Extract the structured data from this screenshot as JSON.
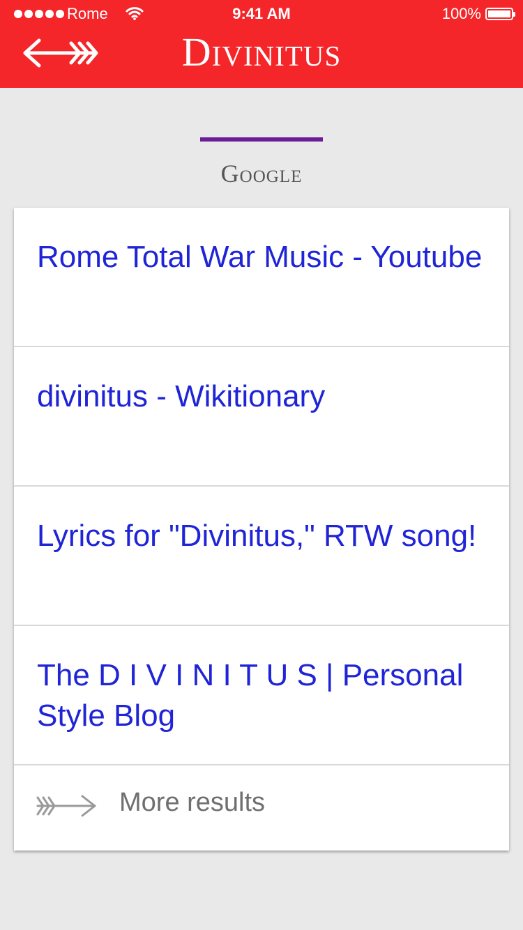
{
  "status_bar": {
    "carrier": "Rome",
    "time": "9:41 AM",
    "battery": "100%"
  },
  "header": {
    "title": "Divinitus",
    "back_icon": "arrow-left-icon",
    "background_color": "#f5262a"
  },
  "section": {
    "title": "Google",
    "accent_color": "#6b1d95"
  },
  "results": [
    {
      "title": "Rome Total War Music - Youtube"
    },
    {
      "title": "divinitus - Wikitionary"
    },
    {
      "title": "Lyrics for \"Divinitus,\" RTW song!"
    },
    {
      "title": "The D I V I N I T U S | Personal Style Blog"
    }
  ],
  "more": {
    "label": "More results",
    "icon": "arrow-right-icon"
  },
  "colors": {
    "link": "#1f24d6",
    "background": "#e9e9e9"
  }
}
